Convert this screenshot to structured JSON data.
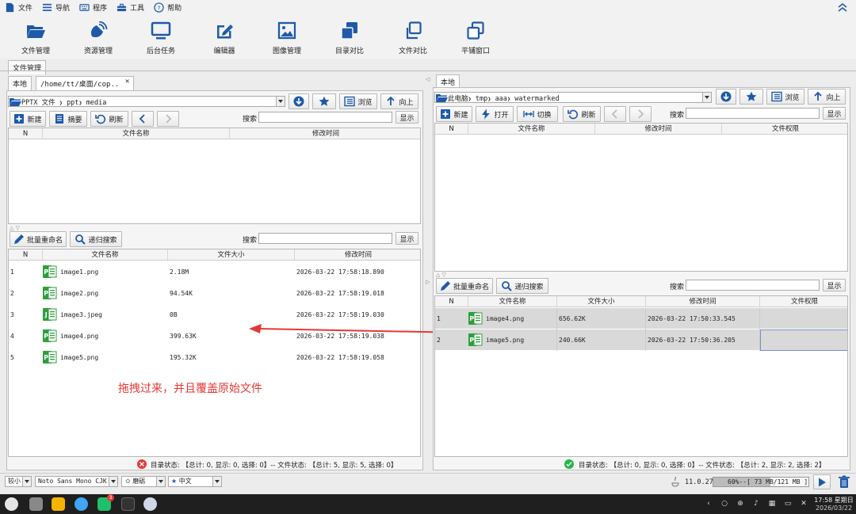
{
  "menu": {
    "file": "文件",
    "nav": "导航",
    "program": "程序",
    "tools": "工具",
    "help": "帮助"
  },
  "toolbar": {
    "file_manager": "文件管理",
    "resource_manager": "资源管理",
    "background_tasks": "后台任务",
    "editor": "编辑器",
    "image_manager": "图像管理",
    "dir_compare": "目录对比",
    "file_compare": "文件对比",
    "tile_window": "平铺窗口"
  },
  "main_tab": "文件管理",
  "left": {
    "tab_local": "本地",
    "tab_path": "/home/tt/桌面/cop..",
    "breadcrumb": [
      "PPTX 文件",
      "ppt",
      "media"
    ],
    "browse": "浏览",
    "up": "向上",
    "new": "新建",
    "summary": "摘要",
    "refresh": "刷新",
    "search_label": "搜索",
    "show": "显示",
    "top_headers": [
      "N",
      "文件名称",
      "修改时间"
    ],
    "batch_rename": "批量重命名",
    "recursive_search": "递归搜索",
    "search_label2": "搜索",
    "show2": "显示",
    "headers": [
      "N",
      "文件名称",
      "文件大小",
      "修改时间"
    ],
    "rows": [
      {
        "n": "1",
        "name": "image1.png",
        "size": "2.18M",
        "time": "2026-03-22 17:58:18.890",
        "type": "P"
      },
      {
        "n": "2",
        "name": "image2.png",
        "size": "94.54K",
        "time": "2026-03-22 17:58:19.018",
        "type": "P"
      },
      {
        "n": "3",
        "name": "image3.jpeg",
        "size": "0B",
        "time": "2026-03-22 17:58:19.030",
        "type": "J"
      },
      {
        "n": "4",
        "name": "image4.png",
        "size": "399.63K",
        "time": "2026-03-22 17:58:19.038",
        "type": "P"
      },
      {
        "n": "5",
        "name": "image5.png",
        "size": "195.32K",
        "time": "2026-03-22 17:58:19.058",
        "type": "P"
      }
    ],
    "annotation": "拖拽过来，并且覆盖原始文件",
    "status": "目录状态: 【总计: 0, 显示: 0, 选择: 0】-- 文件状态: 【总计: 5, 显示: 5, 选择: 0】"
  },
  "right": {
    "tab_local": "本地",
    "breadcrumb": [
      "此电脑",
      "tmp",
      "aaa",
      "watermarked"
    ],
    "browse": "浏览",
    "up": "向上",
    "search_label": "搜索",
    "show": "显示",
    "new": "新建",
    "open": "打开",
    "switch": "切换",
    "refresh": "刷新",
    "top_headers": [
      "N",
      "文件名称",
      "修改时间",
      "文件权限"
    ],
    "batch_rename": "批量重命名",
    "recursive_search": "递归搜索",
    "search_label2": "搜索",
    "show2": "显示",
    "headers": [
      "N",
      "文件名称",
      "文件大小",
      "修改时间",
      "文件权限"
    ],
    "rows": [
      {
        "n": "1",
        "name": "image4.png",
        "size": "656.62K",
        "time": "2026-03-22 17:50:33.545",
        "type": "P"
      },
      {
        "n": "2",
        "name": "image5.png",
        "size": "240.66K",
        "time": "2026-03-22 17:50:36.205",
        "type": "P"
      }
    ],
    "status": "目录状态: 【总计: 0, 显示: 0, 选择: 0】-- 文件状态: 【总计: 2, 显示: 2, 选择: 2】"
  },
  "bottom": {
    "size": "较小",
    "font": "Noto Sans Mono CJK SC",
    "theme": "磨砺",
    "lang": "中文",
    "java_version": "11.0.27",
    "memory": "60%--[ 73 MB/121 MB ]",
    "memory_fraction": 0.6
  },
  "taskbar": {
    "time": "17:58 星期日",
    "date": "2026/03/22",
    "badge": "3"
  },
  "colors": {
    "accent": "#1e5aa8",
    "annotation": "#e53935",
    "selected_row": "#d9d9d9"
  }
}
